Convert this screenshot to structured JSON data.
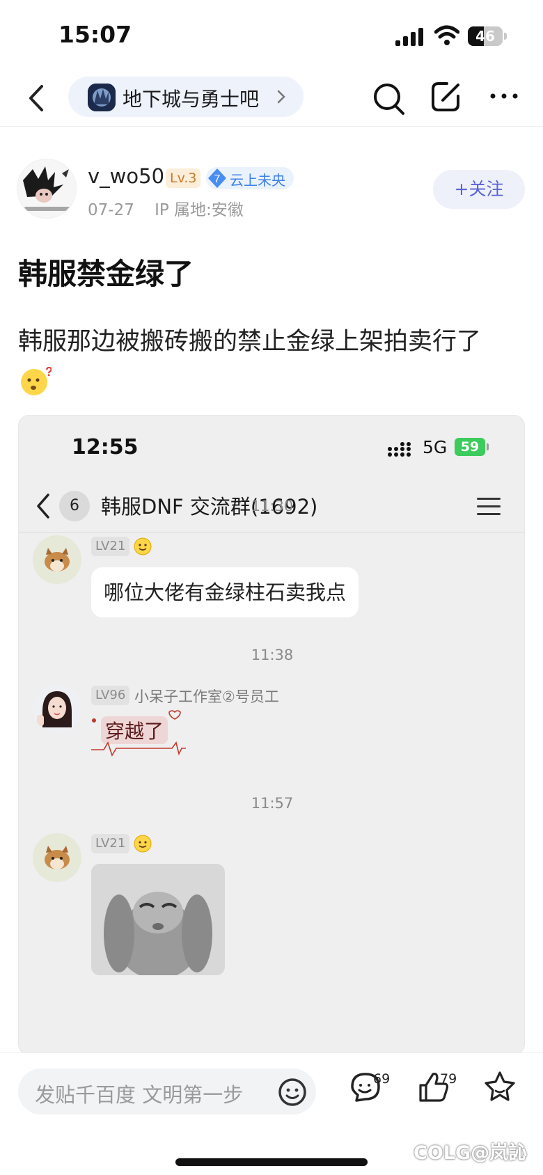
{
  "status_bar": {
    "time": "15:07",
    "battery": "46",
    "battery_level": 0.46
  },
  "nav": {
    "forum_name": "地下城与勇士吧"
  },
  "author": {
    "name": "v_wo50",
    "level": "Lv.3",
    "title_level": "7",
    "title": "云上未央",
    "date": "07-27",
    "ip": "IP 属地:安徽",
    "follow_label": "+关注"
  },
  "post": {
    "title": "韩服禁金绿了",
    "body": "韩服那边被搬砖搬的禁止金绿上架拍卖行了"
  },
  "embed": {
    "time": "12:55",
    "network": "5G",
    "battery": "59",
    "unread": "6",
    "group_title": "韩服DNF 交流群(1692)",
    "messages": [
      {
        "time": "11:30",
        "level": "LV21",
        "text": "哪位大佬有金绿柱石卖我点"
      },
      {
        "time": "11:38",
        "level": "LV96",
        "sender": "小呆子工作室②号员工",
        "text": "穿越了"
      },
      {
        "time": "11:57",
        "level": "LV21"
      }
    ]
  },
  "bottom": {
    "placeholder": "发贴千百度 文明第一步",
    "comment_count": "69",
    "like_count": "79",
    "watermark": "COLG@岚訫"
  }
}
